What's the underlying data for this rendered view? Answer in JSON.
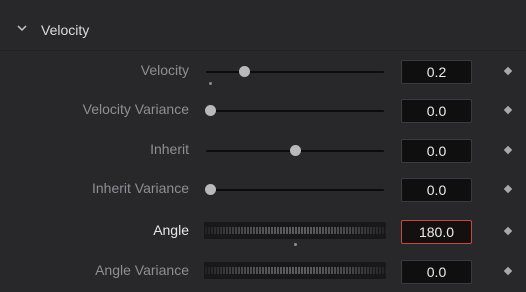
{
  "section": {
    "title": "Velocity",
    "icon": "chevron-down-icon"
  },
  "controls": [
    {
      "label": "Velocity",
      "value": "0.2",
      "type": "slider",
      "active": false
    },
    {
      "label": "Velocity Variance",
      "value": "0.0",
      "type": "slider",
      "active": false
    },
    {
      "label": "Inherit",
      "value": "0.0",
      "type": "slider",
      "active": false
    },
    {
      "label": "Inherit Variance",
      "value": "0.0",
      "type": "slider",
      "active": false
    },
    {
      "label": "Angle",
      "value": "180.0",
      "type": "thumbwheel",
      "active": true
    },
    {
      "label": "Angle Variance",
      "value": "0.0",
      "type": "thumbwheel",
      "active": false
    }
  ],
  "colors": {
    "panel_bg": "#28282b",
    "highlight_border": "#c64a3c",
    "label_dim": "#8e8e93",
    "label_active": "#e6e6e9"
  }
}
